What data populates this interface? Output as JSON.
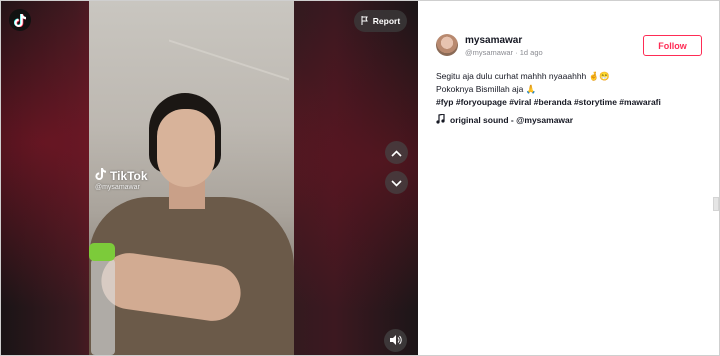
{
  "player": {
    "watermark_brand": "TikTok",
    "watermark_user": "@mysamawar",
    "report_label": "Report"
  },
  "author": {
    "username": "mysamawar",
    "handle": "@mysamawar",
    "separator": " · ",
    "posted": "1d ago",
    "follow_label": "Follow"
  },
  "caption": {
    "line1": "Segitu aja dulu curhat mahhh nyaaahhh 🤞😁",
    "line2": "Pokoknya Bismillah aja 🙏",
    "hashtags": "#fyp #foryoupage #viral #beranda #storytime #mawarafi"
  },
  "music": {
    "label": "original sound - @mysamawar"
  },
  "icons": {
    "logo": "tiktok-logo-icon",
    "report": "flag-icon",
    "up": "chevron-up-icon",
    "down": "chevron-down-icon",
    "sound": "speaker-icon",
    "music": "music-note-icon"
  },
  "colors": {
    "accent": "#fe2c55",
    "text": "#161823",
    "muted": "#8a8b91"
  }
}
